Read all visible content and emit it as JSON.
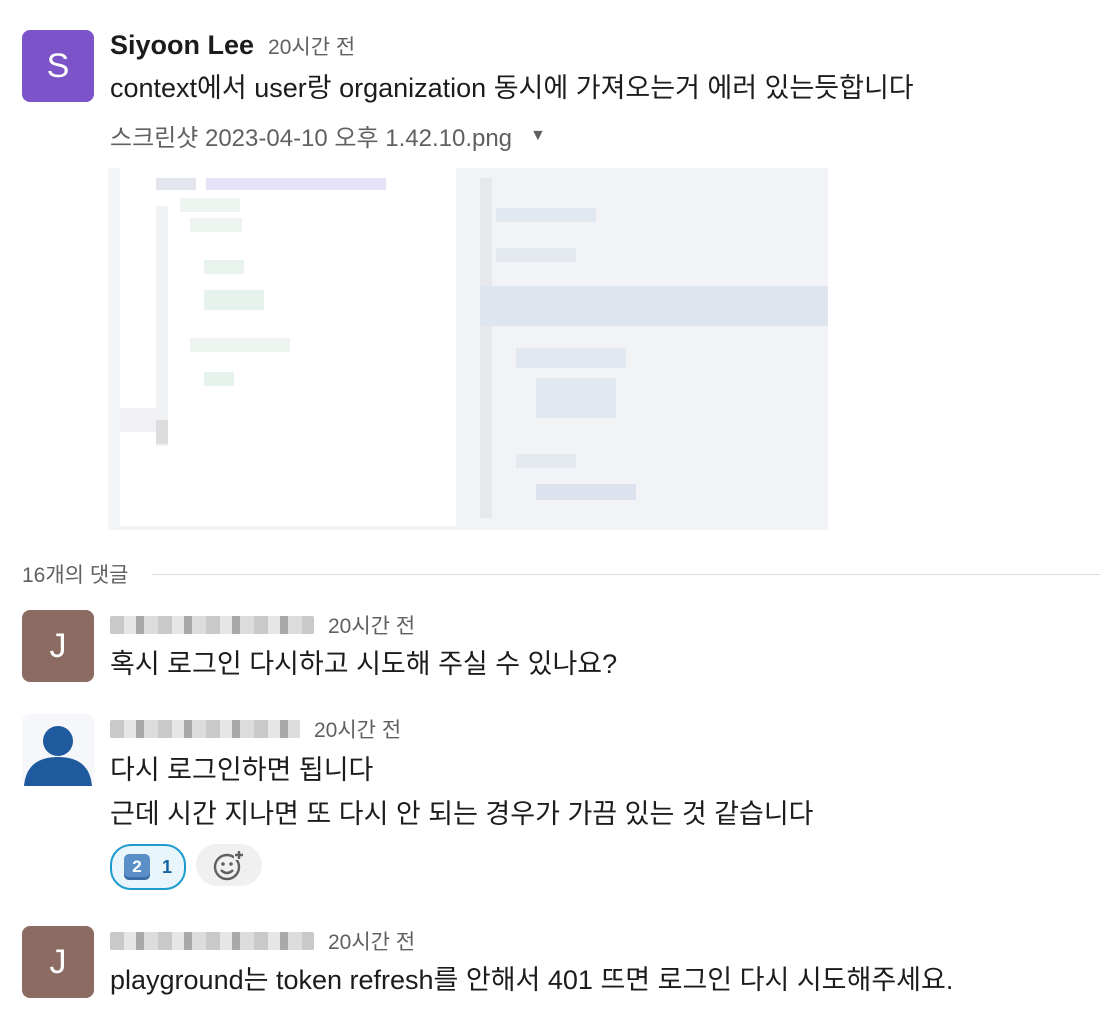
{
  "messages": [
    {
      "avatar_letter": "S",
      "avatar_color": "#7c53c9",
      "author": "Siyoon Lee",
      "time": "20시간 전",
      "text": "context에서 user랑 organization 동시에 가져오는거 에러 있는듯합니다",
      "attachment": {
        "filename": "스크린샷 2023-04-10 오후 1.42.10.png",
        "caret_icon": "caret-down-icon"
      }
    }
  ],
  "thread": {
    "reply_count_label": "16개의 댓글"
  },
  "replies": [
    {
      "avatar_letter": "J",
      "avatar_color": "#8b6b62",
      "time": "20시간 전",
      "lines": [
        "혹시 로그인 다시하고 시도해 주실 수 있나요?"
      ]
    },
    {
      "avatar_icon": "default-user-icon",
      "avatar_color": "#1f5a9e",
      "time": "20시간 전",
      "lines": [
        "다시 로그인하면 됩니다",
        "근데 시간 지나면 또 다시 안 되는 경우가 가끔 있는 것 같습니다"
      ],
      "reactions": [
        {
          "emoji": "2",
          "count": "1"
        }
      ],
      "add_reaction_icon": "add-reaction-icon"
    },
    {
      "avatar_letter": "J",
      "avatar_color": "#8b6b62",
      "time": "20시간 전",
      "lines": [
        "playground는 token refresh를 안해서 401 뜨면 로그인 다시 시도해주세요."
      ]
    }
  ]
}
